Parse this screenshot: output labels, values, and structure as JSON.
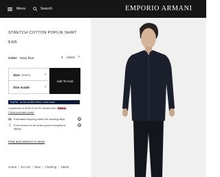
{
  "header": {
    "menu_label": "Menu",
    "search_label": "Search",
    "brand_logo": "EMPORIO ARMANI"
  },
  "product": {
    "title": "STRETCH COTTON POPLIN SHIRT",
    "price": "$ 425",
    "color_label": "Color:",
    "color_value": "Navy blue",
    "colors_count": "4",
    "colors_word": "colors"
  },
  "selectors": {
    "size_label": "Size:",
    "size_value": "Select",
    "guide_label": "Size Guide"
  },
  "cart": {
    "add_label": "Add To Cart"
  },
  "paypal": {
    "logo": "PayPal",
    "text": "As low as $40.40/mo. Learn more"
  },
  "klarna": {
    "text": "4 payments of $106.25 at 0% interest with",
    "logo": "Klarna",
    "link": "Check purchase power"
  },
  "info": {
    "shipping": "Estimated shipping within 4/6 working days",
    "returns": "Free returns for all orders (some exceptions apply)",
    "info_mark": "i"
  },
  "store": {
    "find_label": "Find and reserve in store"
  },
  "breadcrumb": {
    "items": [
      "Home",
      "EA US",
      "Man",
      "Clothing",
      "Shirts"
    ],
    "separator": "/"
  },
  "colors": {
    "header_bg": "#161616",
    "shirt": "#1b1f2b",
    "cart_bg": "#111111",
    "paypal_bg": "#0b1a39",
    "klarna_pink": "#ffb3c7"
  }
}
